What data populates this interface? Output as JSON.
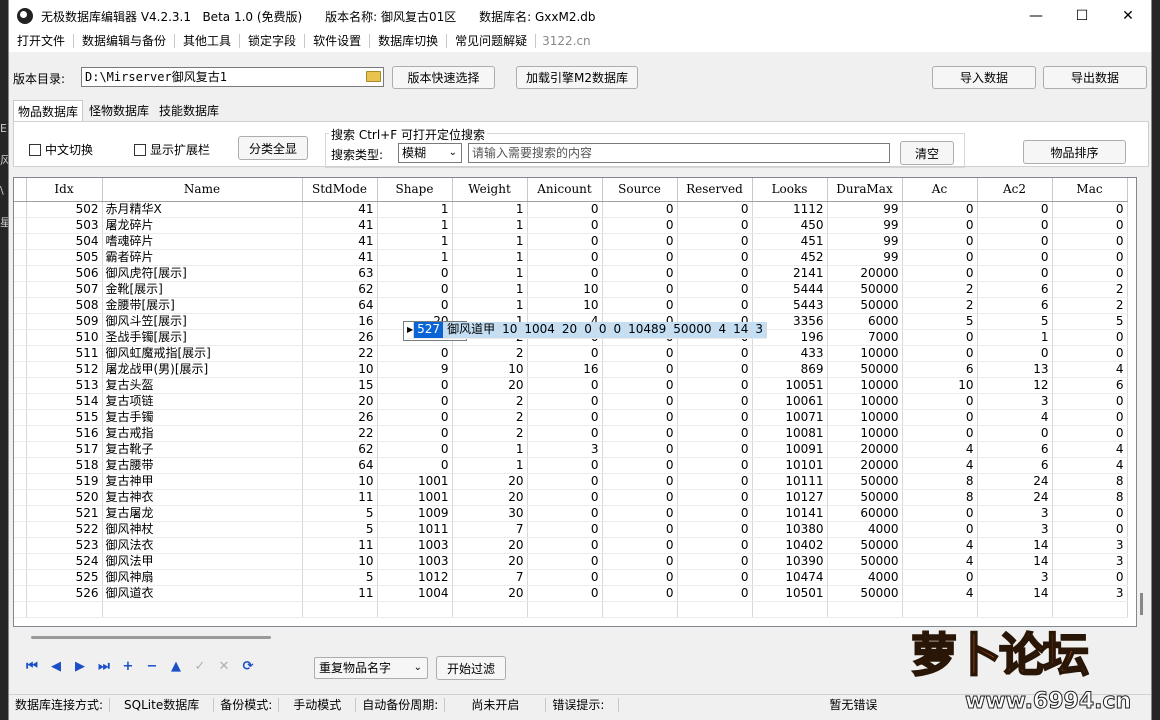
{
  "title": {
    "text": "无极数据库编辑器 V4.2.3.1   Beta 1.0 (免费版)      版本名称: 御风复古01区      数据库名: GxxM2.db"
  },
  "window_buttons": [
    "—",
    "☐",
    "✕"
  ],
  "menu": [
    "打开文件",
    "数据编辑与备份",
    "其他工具",
    "锁定字段",
    "软件设置",
    "数据库切换",
    "常见问题解疑"
  ],
  "menu_site": "3122.cn",
  "toolbar": {
    "dir_label": "版本目录:",
    "dir_value": "D:\\Mirserver御风复古1",
    "quick_select": "版本快速选择",
    "load_engine": "加载引擎M2数据库",
    "import": "导入数据",
    "export": "导出数据"
  },
  "tabs": [
    "物品数据库",
    "怪物数据库",
    "技能数据库"
  ],
  "options": {
    "chinese_switch": "中文切换",
    "show_ext": "显示扩展栏",
    "category_all": "分类全显",
    "search_title": "搜索  Ctrl+F 可打开定位搜索",
    "search_type_label": "搜索类型:",
    "search_type_value": "模糊",
    "search_placeholder": "请输入需要搜索的内容",
    "clear": "清空",
    "sort": "物品排序"
  },
  "table": {
    "columns": [
      "Idx",
      "Name",
      "StdMode",
      "Shape",
      "Weight",
      "Anicount",
      "Source",
      "Reserved",
      "Looks",
      "DuraMax",
      "Ac",
      "Ac2",
      "Mac"
    ],
    "rows": [
      [
        "502",
        "赤月精华X",
        "41",
        "1",
        "1",
        "0",
        "0",
        "0",
        "1112",
        "99",
        "0",
        "0",
        "0"
      ],
      [
        "503",
        "屠龙碎片",
        "41",
        "1",
        "1",
        "0",
        "0",
        "0",
        "450",
        "99",
        "0",
        "0",
        "0"
      ],
      [
        "504",
        "嗜魂碎片",
        "41",
        "1",
        "1",
        "0",
        "0",
        "0",
        "451",
        "99",
        "0",
        "0",
        "0"
      ],
      [
        "505",
        "霸者碎片",
        "41",
        "1",
        "1",
        "0",
        "0",
        "0",
        "452",
        "99",
        "0",
        "0",
        "0"
      ],
      [
        "506",
        "御风虎符[展示]",
        "63",
        "0",
        "1",
        "0",
        "0",
        "0",
        "2141",
        "20000",
        "0",
        "0",
        "0"
      ],
      [
        "507",
        "金靴[展示]",
        "62",
        "0",
        "1",
        "10",
        "0",
        "0",
        "5444",
        "50000",
        "2",
        "6",
        "2"
      ],
      [
        "508",
        "金腰带[展示]",
        "64",
        "0",
        "1",
        "10",
        "0",
        "0",
        "5443",
        "50000",
        "2",
        "6",
        "2"
      ],
      [
        "509",
        "御风斗笠[展示]",
        "16",
        "20",
        "1",
        "4",
        "0",
        "0",
        "3356",
        "6000",
        "5",
        "5",
        "5"
      ],
      [
        "510",
        "圣战手镯[展示]",
        "26",
        "0",
        "2",
        "0",
        "0",
        "0",
        "196",
        "7000",
        "0",
        "1",
        "0"
      ],
      [
        "511",
        "御风虹魔戒指[展示]",
        "22",
        "0",
        "2",
        "0",
        "0",
        "0",
        "433",
        "10000",
        "0",
        "0",
        "0"
      ],
      [
        "512",
        "屠龙战甲(男)[展示]",
        "10",
        "9",
        "10",
        "16",
        "0",
        "0",
        "869",
        "50000",
        "6",
        "13",
        "4"
      ],
      [
        "513",
        "复古头盔",
        "15",
        "0",
        "20",
        "0",
        "0",
        "0",
        "10051",
        "10000",
        "10",
        "12",
        "6"
      ],
      [
        "514",
        "复古项链",
        "20",
        "0",
        "2",
        "0",
        "0",
        "0",
        "10061",
        "10000",
        "0",
        "3",
        "0"
      ],
      [
        "515",
        "复古手镯",
        "26",
        "0",
        "2",
        "0",
        "0",
        "0",
        "10071",
        "10000",
        "0",
        "4",
        "0"
      ],
      [
        "516",
        "复古戒指",
        "22",
        "0",
        "2",
        "0",
        "0",
        "0",
        "10081",
        "10000",
        "0",
        "0",
        "0"
      ],
      [
        "517",
        "复古靴子",
        "62",
        "0",
        "1",
        "3",
        "0",
        "0",
        "10091",
        "20000",
        "4",
        "6",
        "4"
      ],
      [
        "518",
        "复古腰带",
        "64",
        "0",
        "1",
        "0",
        "0",
        "0",
        "10101",
        "20000",
        "4",
        "6",
        "4"
      ],
      [
        "519",
        "复古神甲",
        "10",
        "1001",
        "20",
        "0",
        "0",
        "0",
        "10111",
        "50000",
        "8",
        "24",
        "8"
      ],
      [
        "520",
        "复古神衣",
        "11",
        "1001",
        "20",
        "0",
        "0",
        "0",
        "10127",
        "50000",
        "8",
        "24",
        "8"
      ],
      [
        "521",
        "复古屠龙",
        "5",
        "1009",
        "30",
        "0",
        "0",
        "0",
        "10141",
        "60000",
        "0",
        "3",
        "0"
      ],
      [
        "522",
        "御风神杖",
        "5",
        "1011",
        "7",
        "0",
        "0",
        "0",
        "10380",
        "4000",
        "0",
        "3",
        "0"
      ],
      [
        "523",
        "御风法衣",
        "11",
        "1003",
        "20",
        "0",
        "0",
        "0",
        "10402",
        "50000",
        "4",
        "14",
        "3"
      ],
      [
        "524",
        "御风法甲",
        "10",
        "1003",
        "20",
        "0",
        "0",
        "0",
        "10390",
        "50000",
        "4",
        "14",
        "3"
      ],
      [
        "525",
        "御风神扇",
        "5",
        "1012",
        "7",
        "0",
        "0",
        "0",
        "10474",
        "4000",
        "0",
        "3",
        "0"
      ],
      [
        "526",
        "御风道衣",
        "11",
        "1004",
        "20",
        "0",
        "0",
        "0",
        "10501",
        "50000",
        "4",
        "14",
        "3"
      ],
      [
        "527",
        "御风道甲",
        "10",
        "1004",
        "20",
        "0",
        "0",
        "0",
        "10489",
        "50000",
        "4",
        "14",
        "3"
      ]
    ],
    "selected_index": 25
  },
  "nav_icons": [
    "first-icon",
    "prev-icon",
    "next-icon",
    "last-icon",
    "add-icon",
    "delete-icon",
    "up-icon",
    "confirm-icon",
    "cancel-icon",
    "refresh-icon"
  ],
  "filter": {
    "select_value": "重复物品名字",
    "button": "开始过滤"
  },
  "status": [
    "数据库连接方式:",
    "SQLite数据库",
    "备份模式:",
    "手动模式",
    "自动备份周期:",
    "尚未开启",
    "错误提示:",
    "暂无错误"
  ],
  "watermark": {
    "text": "萝卜论坛",
    "url": "www.6994.cn"
  },
  "desktop_left": [
    "E",
    "风",
    "\\",
    "星"
  ],
  "colors": {
    "selected_row": "#c4dff4",
    "current_cell": "#0a64d6",
    "nav_icon": "#1a4fc7",
    "watermark": "#f26b1d"
  }
}
